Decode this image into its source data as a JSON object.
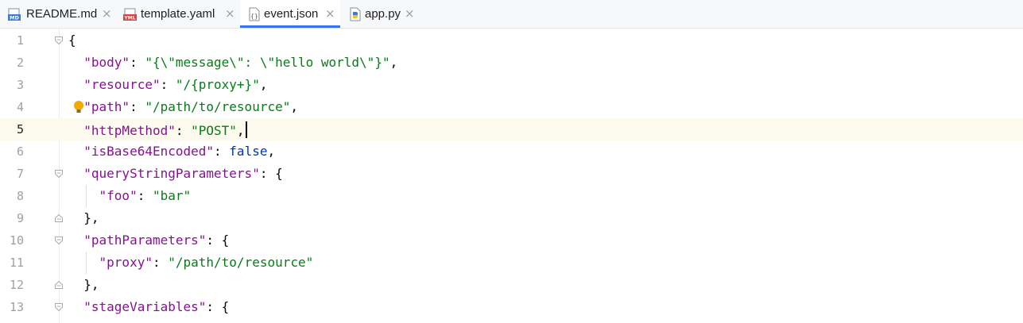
{
  "tabs": [
    {
      "label": "README.md",
      "icon": "markdown-file-icon",
      "active": false,
      "closable": true
    },
    {
      "label": "template.yaml",
      "icon": "yaml-file-icon",
      "active": false,
      "closable": true
    },
    {
      "label": "event.json",
      "icon": "json-file-icon",
      "active": true,
      "closable": true
    },
    {
      "label": "app.py",
      "icon": "python-file-icon",
      "active": false,
      "closable": true
    }
  ],
  "icon_text": {
    "markdown": "MD",
    "yaml": "YML",
    "json": "{}"
  },
  "close_glyph": "×",
  "editor": {
    "current_line": 5,
    "lines": [
      {
        "number": "1",
        "tokens": [
          {
            "t": "{",
            "c": "punct"
          }
        ]
      },
      {
        "number": "2",
        "tokens": [
          {
            "t": "  ",
            "c": "punct"
          },
          {
            "t": "\"body\"",
            "c": "key"
          },
          {
            "t": ": ",
            "c": "punct"
          },
          {
            "t": "\"{\\\"message\\\": \\\"hello world\\\"}\"",
            "c": "str"
          },
          {
            "t": ",",
            "c": "punct"
          }
        ]
      },
      {
        "number": "3",
        "tokens": [
          {
            "t": "  ",
            "c": "punct"
          },
          {
            "t": "\"resource\"",
            "c": "key"
          },
          {
            "t": ": ",
            "c": "punct"
          },
          {
            "t": "\"/{proxy+}\"",
            "c": "str"
          },
          {
            "t": ",",
            "c": "punct"
          }
        ]
      },
      {
        "number": "4",
        "tokens": [
          {
            "t": "  ",
            "c": "punct"
          },
          {
            "t": "\"path\"",
            "c": "key"
          },
          {
            "t": ": ",
            "c": "punct"
          },
          {
            "t": "\"/path/to/resource\"",
            "c": "str"
          },
          {
            "t": ",",
            "c": "punct"
          }
        ]
      },
      {
        "number": "5",
        "tokens": [
          {
            "t": "  ",
            "c": "punct"
          },
          {
            "t": "\"httpMethod\"",
            "c": "key"
          },
          {
            "t": ": ",
            "c": "punct"
          },
          {
            "t": "\"POST\"",
            "c": "str"
          },
          {
            "t": ",",
            "c": "punct"
          }
        ]
      },
      {
        "number": "6",
        "tokens": [
          {
            "t": "  ",
            "c": "punct"
          },
          {
            "t": "\"isBase64Encoded\"",
            "c": "key"
          },
          {
            "t": ": ",
            "c": "punct"
          },
          {
            "t": "false",
            "c": "kw"
          },
          {
            "t": ",",
            "c": "punct"
          }
        ]
      },
      {
        "number": "7",
        "tokens": [
          {
            "t": "  ",
            "c": "punct"
          },
          {
            "t": "\"queryStringParameters\"",
            "c": "key"
          },
          {
            "t": ": {",
            "c": "punct"
          }
        ]
      },
      {
        "number": "8",
        "tokens": [
          {
            "t": "    ",
            "c": "punct"
          },
          {
            "t": "\"foo\"",
            "c": "key"
          },
          {
            "t": ": ",
            "c": "punct"
          },
          {
            "t": "\"bar\"",
            "c": "str"
          }
        ]
      },
      {
        "number": "9",
        "tokens": [
          {
            "t": "  },",
            "c": "punct"
          }
        ]
      },
      {
        "number": "10",
        "tokens": [
          {
            "t": "  ",
            "c": "punct"
          },
          {
            "t": "\"pathParameters\"",
            "c": "key"
          },
          {
            "t": ": {",
            "c": "punct"
          }
        ]
      },
      {
        "number": "11",
        "tokens": [
          {
            "t": "    ",
            "c": "punct"
          },
          {
            "t": "\"proxy\"",
            "c": "key"
          },
          {
            "t": ": ",
            "c": "punct"
          },
          {
            "t": "\"/path/to/resource\"",
            "c": "str"
          }
        ]
      },
      {
        "number": "12",
        "tokens": [
          {
            "t": "  },",
            "c": "punct"
          }
        ]
      },
      {
        "number": "13",
        "tokens": [
          {
            "t": "  ",
            "c": "punct"
          },
          {
            "t": "\"stageVariables\"",
            "c": "key"
          },
          {
            "t": ": {",
            "c": "punct"
          }
        ]
      }
    ],
    "fold_markers": {
      "1": "open",
      "7": "open",
      "9": "close",
      "10": "open",
      "12": "close",
      "13": "open"
    },
    "intention_bulb_line": 4,
    "colors": {
      "key": "#871094",
      "string": "#067d17",
      "keyword": "#0033b3",
      "current_line_bg": "#fcfaed",
      "active_tab_underline": "#3574f0",
      "bulb": "#f2a900"
    }
  }
}
